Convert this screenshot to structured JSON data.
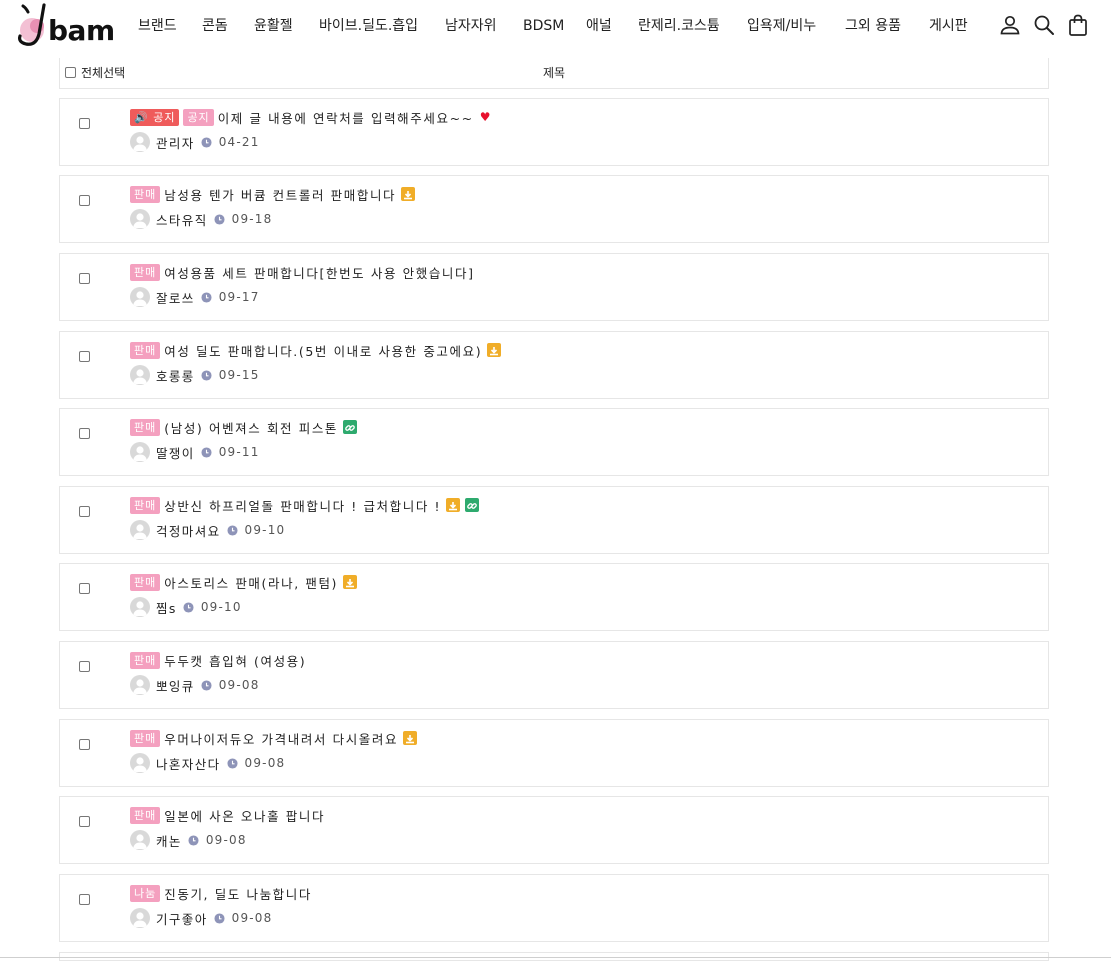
{
  "brand": {
    "logo_text": "bam",
    "accent": "#e8a6c1"
  },
  "nav": {
    "items": [
      {
        "label": "브랜드"
      },
      {
        "label": "콘돔"
      },
      {
        "label": "윤활젤"
      },
      {
        "label": "바이브.딜도.흡입"
      },
      {
        "label": "남자자위"
      },
      {
        "label": "BDSM"
      },
      {
        "label": "애널"
      },
      {
        "label": "란제리.코스튬"
      },
      {
        "label": "입욕제/비누"
      },
      {
        "label": "그외 용품"
      },
      {
        "label": "게시판"
      }
    ],
    "icons": [
      "user-icon",
      "search-icon",
      "shopping-bag-icon"
    ]
  },
  "list_header": {
    "select_all_label": "전체선택",
    "title_col": "제목"
  },
  "posts": [
    {
      "notice_label": "🔊 공지",
      "badge": "공지",
      "subject": "이제 글 내용에 연락처를 입력해주세요~~",
      "extras": [
        "heart"
      ],
      "author": "관리자",
      "date": "04-21"
    },
    {
      "badge": "판매",
      "subject": "남성용 텐가 버큠 컨트롤러 판매합니다",
      "extras": [
        "download"
      ],
      "author": "스타유직",
      "date": "09-18"
    },
    {
      "badge": "판매",
      "subject": "여성용품 세트 판매합니다[한번도 사용 안했습니다]",
      "extras": [],
      "author": "잘로쓰",
      "date": "09-17"
    },
    {
      "badge": "판매",
      "subject": "여성 딜도 판매합니다.(5번 이내로 사용한 중고에요)",
      "extras": [
        "download"
      ],
      "author": "호롱롱",
      "date": "09-15"
    },
    {
      "badge": "판매",
      "subject": "(남성) 어벤져스 회전 피스톤",
      "extras": [
        "link"
      ],
      "author": "딸쟁이",
      "date": "09-11"
    },
    {
      "badge": "판매",
      "subject": "상반신 하프리얼돌 판매합니다 ! 급처합니다 !",
      "extras": [
        "download",
        "link"
      ],
      "author": "걱정마셔요",
      "date": "09-10"
    },
    {
      "badge": "판매",
      "subject": "아스토리스 판매(라나, 팬텀)",
      "extras": [
        "download"
      ],
      "author": "찜s",
      "date": "09-10"
    },
    {
      "badge": "판매",
      "subject": "두두캣 흡입혀 (여성용)",
      "extras": [],
      "author": "뽀잉큐",
      "date": "09-08"
    },
    {
      "badge": "판매",
      "subject": "우머나이저듀오 가격내려서 다시올려요",
      "extras": [
        "download"
      ],
      "author": "나혼자산다",
      "date": "09-08"
    },
    {
      "badge": "판매",
      "subject": "일본에 사온 오나홀 팝니다",
      "extras": [],
      "author": "캐논",
      "date": "09-08"
    },
    {
      "badge": "나눔",
      "subject": "진동기, 딜도 나눔합니다",
      "extras": [],
      "author": "기구좋아",
      "date": "09-08"
    }
  ]
}
